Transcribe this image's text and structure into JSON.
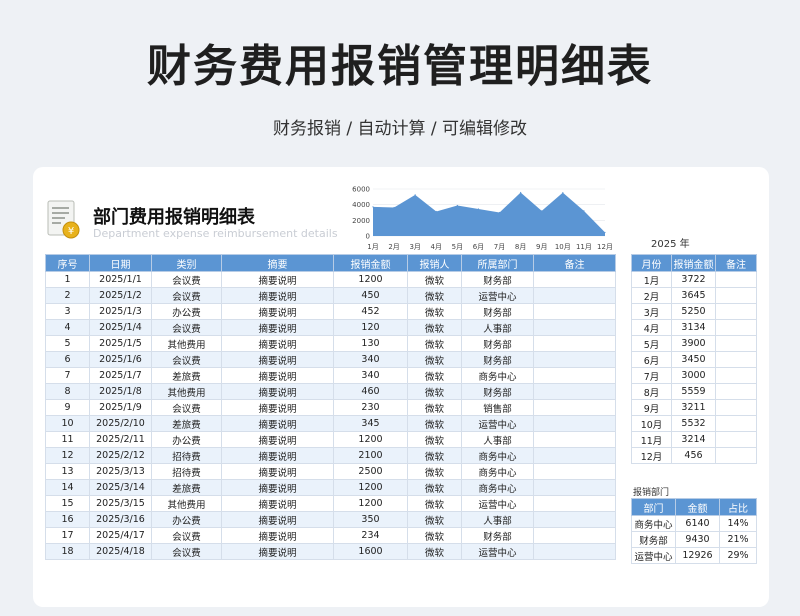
{
  "header": {
    "title": "财务费用报销管理明细表",
    "subtitle": "财务报销 / 自动计算 / 可编辑修改"
  },
  "sheet": {
    "title": "部门费用报销明细表",
    "title_en": "Department expense reimbursement details",
    "icon": "document-coin-icon",
    "year_label": "2025 年"
  },
  "colors": {
    "header_bg": "#5b95d3",
    "area_fill": "#5b95d3",
    "row_alt": "#eaf2fb"
  },
  "chart_data": {
    "type": "area",
    "categories": [
      "1月",
      "2月",
      "3月",
      "4月",
      "5月",
      "6月",
      "7月",
      "8月",
      "9月",
      "10月",
      "11月",
      "12月"
    ],
    "values": [
      3722,
      3645,
      5250,
      3134,
      3900,
      3450,
      3000,
      5559,
      3211,
      5532,
      3214,
      456
    ],
    "yticks": [
      0,
      2000,
      4000,
      6000
    ],
    "ylim": [
      0,
      6000
    ]
  },
  "main_table": {
    "columns": [
      "序号",
      "日期",
      "类别",
      "摘要",
      "报销金额",
      "报销人",
      "所属部门",
      "备注"
    ],
    "rows": [
      [
        "1",
        "2025/1/1",
        "会议费",
        "摘要说明",
        "1200",
        "微软",
        "财务部",
        ""
      ],
      [
        "2",
        "2025/1/2",
        "会议费",
        "摘要说明",
        "450",
        "微软",
        "运营中心",
        ""
      ],
      [
        "3",
        "2025/1/3",
        "办公费",
        "摘要说明",
        "452",
        "微软",
        "财务部",
        ""
      ],
      [
        "4",
        "2025/1/4",
        "会议费",
        "摘要说明",
        "120",
        "微软",
        "人事部",
        ""
      ],
      [
        "5",
        "2025/1/5",
        "其他费用",
        "摘要说明",
        "130",
        "微软",
        "财务部",
        ""
      ],
      [
        "6",
        "2025/1/6",
        "会议费",
        "摘要说明",
        "340",
        "微软",
        "财务部",
        ""
      ],
      [
        "7",
        "2025/1/7",
        "差旅费",
        "摘要说明",
        "340",
        "微软",
        "商务中心",
        ""
      ],
      [
        "8",
        "2025/1/8",
        "其他费用",
        "摘要说明",
        "460",
        "微软",
        "财务部",
        ""
      ],
      [
        "9",
        "2025/1/9",
        "会议费",
        "摘要说明",
        "230",
        "微软",
        "销售部",
        ""
      ],
      [
        "10",
        "2025/2/10",
        "差旅费",
        "摘要说明",
        "345",
        "微软",
        "运营中心",
        ""
      ],
      [
        "11",
        "2025/2/11",
        "办公费",
        "摘要说明",
        "1200",
        "微软",
        "人事部",
        ""
      ],
      [
        "12",
        "2025/2/12",
        "招待费",
        "摘要说明",
        "2100",
        "微软",
        "商务中心",
        ""
      ],
      [
        "13",
        "2025/3/13",
        "招待费",
        "摘要说明",
        "2500",
        "微软",
        "商务中心",
        ""
      ],
      [
        "14",
        "2025/3/14",
        "差旅费",
        "摘要说明",
        "1200",
        "微软",
        "商务中心",
        ""
      ],
      [
        "15",
        "2025/3/15",
        "其他费用",
        "摘要说明",
        "1200",
        "微软",
        "运营中心",
        ""
      ],
      [
        "16",
        "2025/3/16",
        "办公费",
        "摘要说明",
        "350",
        "微软",
        "人事部",
        ""
      ],
      [
        "17",
        "2025/4/17",
        "会议费",
        "摘要说明",
        "234",
        "微软",
        "财务部",
        ""
      ],
      [
        "18",
        "2025/4/18",
        "会议费",
        "摘要说明",
        "1600",
        "微软",
        "运营中心",
        ""
      ]
    ]
  },
  "month_table": {
    "columns": [
      "月份",
      "报销金额",
      "备注"
    ],
    "rows": [
      [
        "1月",
        "3722",
        ""
      ],
      [
        "2月",
        "3645",
        ""
      ],
      [
        "3月",
        "5250",
        ""
      ],
      [
        "4月",
        "3134",
        ""
      ],
      [
        "5月",
        "3900",
        ""
      ],
      [
        "6月",
        "3450",
        ""
      ],
      [
        "7月",
        "3000",
        ""
      ],
      [
        "8月",
        "5559",
        ""
      ],
      [
        "9月",
        "3211",
        ""
      ],
      [
        "10月",
        "5532",
        ""
      ],
      [
        "11月",
        "3214",
        ""
      ],
      [
        "12月",
        "456",
        ""
      ]
    ]
  },
  "dept_table": {
    "caption": "报销部门",
    "columns": [
      "部门",
      "金额",
      "占比"
    ],
    "rows": [
      [
        "商务中心",
        "6140",
        "14%"
      ],
      [
        "财务部",
        "9430",
        "21%"
      ],
      [
        "运营中心",
        "12926",
        "29%"
      ]
    ]
  }
}
